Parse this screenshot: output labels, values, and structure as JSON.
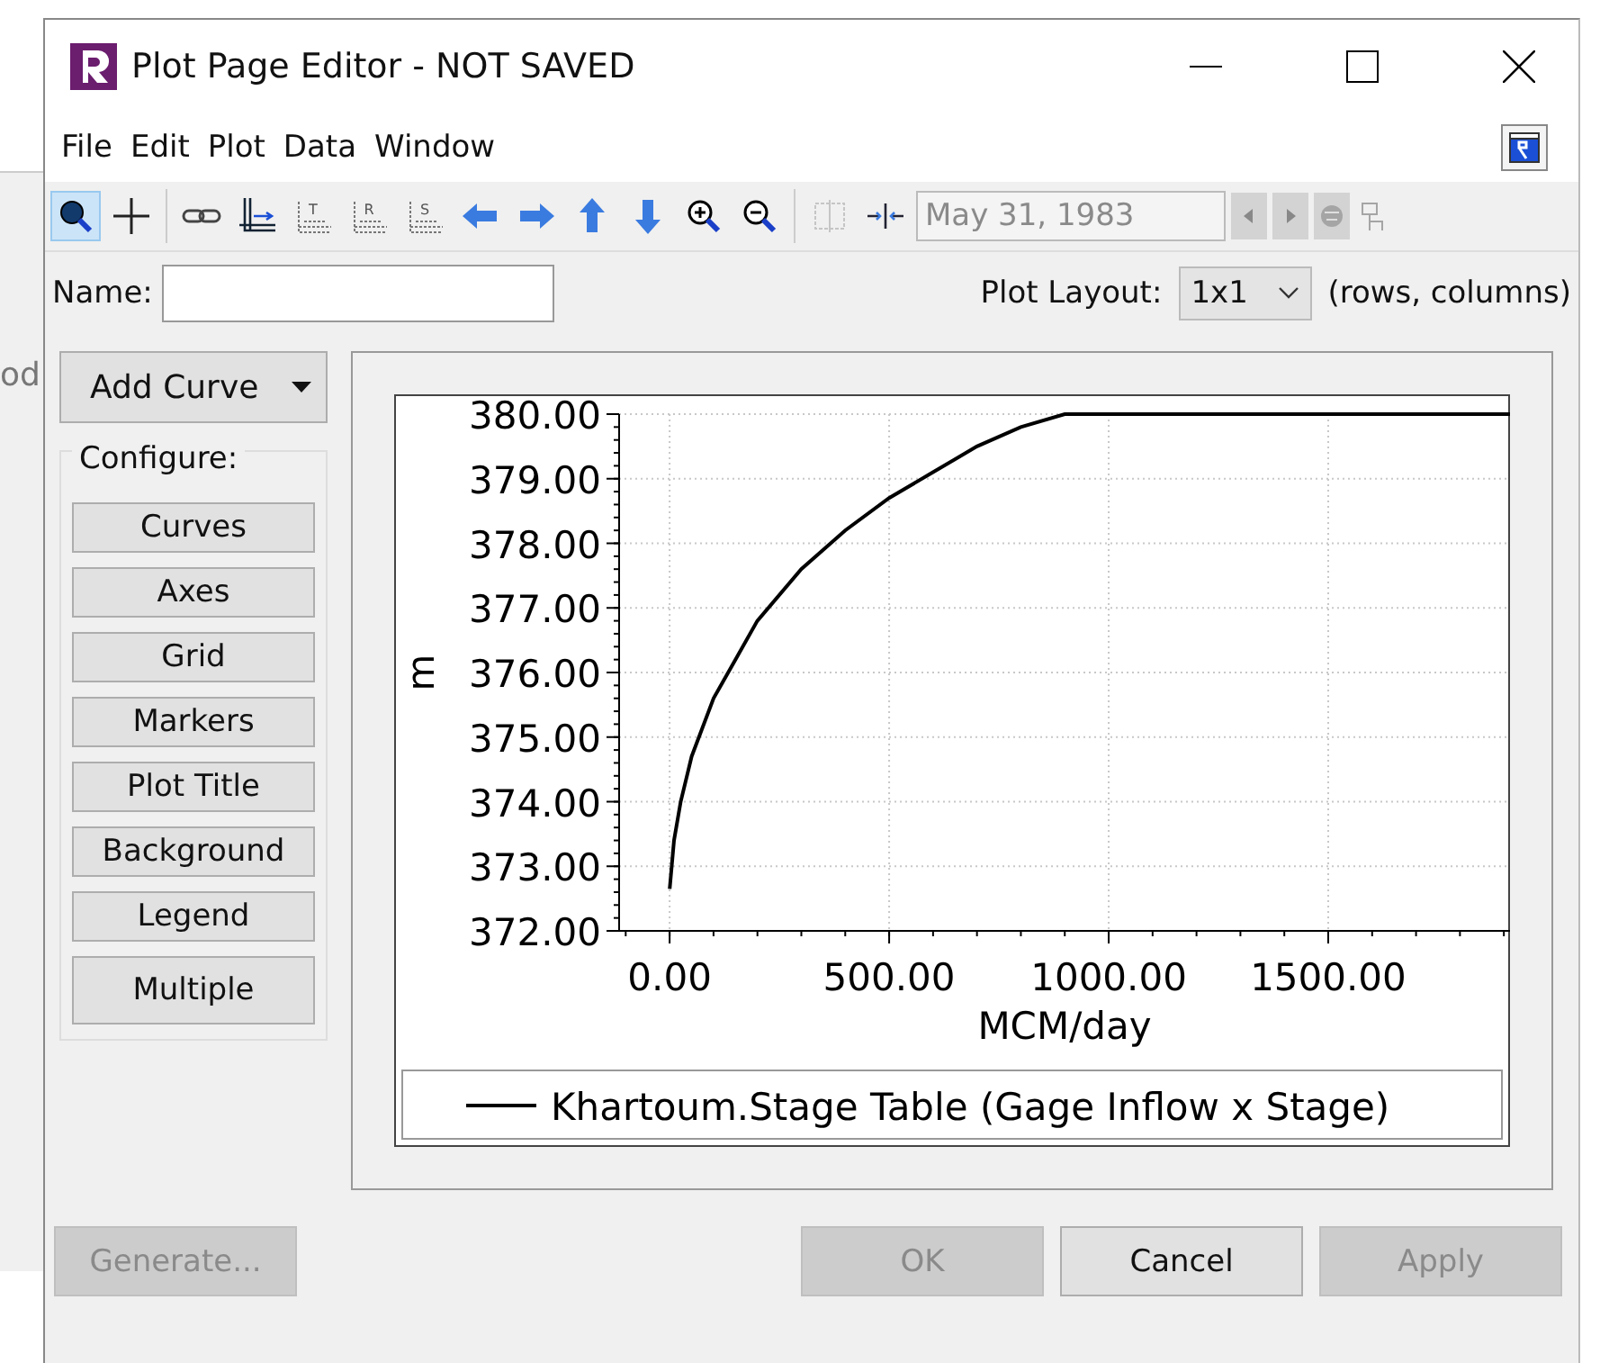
{
  "background_window": {
    "fragment": "od"
  },
  "window": {
    "title": "Plot Page Editor - NOT SAVED",
    "controls": [
      {
        "kind": "minimize"
      },
      {
        "kind": "maximize"
      },
      {
        "kind": "close"
      }
    ]
  },
  "menu": {
    "items": [
      "File",
      "Edit",
      "Plot",
      "Data",
      "Window"
    ]
  },
  "toolbar": {
    "tools": [
      {
        "kind": "zoom-region",
        "selected": true,
        "disabled": false
      },
      {
        "kind": "crosshair",
        "selected": false,
        "disabled": false
      },
      {
        "kind": "sep"
      },
      {
        "kind": "link",
        "selected": false,
        "disabled": false
      },
      {
        "kind": "axis",
        "selected": false,
        "disabled": false
      },
      {
        "kind": "axis-letter",
        "label": "T",
        "selected": false,
        "disabled": false
      },
      {
        "kind": "axis-letter",
        "label": "R",
        "selected": false,
        "disabled": false
      },
      {
        "kind": "axis-letter",
        "label": "S",
        "selected": false,
        "disabled": false
      },
      {
        "kind": "arrow-left",
        "selected": false,
        "disabled": false
      },
      {
        "kind": "arrow-right",
        "selected": false,
        "disabled": false
      },
      {
        "kind": "arrow-up",
        "selected": false,
        "disabled": false
      },
      {
        "kind": "arrow-down",
        "selected": false,
        "disabled": false
      },
      {
        "kind": "zoom-in",
        "selected": false,
        "disabled": false
      },
      {
        "kind": "zoom-out",
        "selected": false,
        "disabled": false
      },
      {
        "kind": "sep"
      },
      {
        "kind": "split",
        "selected": false,
        "disabled": true
      },
      {
        "kind": "compress",
        "selected": false,
        "disabled": false
      }
    ],
    "date_field": {
      "value": "May 31, 1983",
      "disabled": true
    },
    "date_tools": [
      {
        "kind": "prev",
        "disabled": true
      },
      {
        "kind": "next",
        "disabled": true
      },
      {
        "kind": "globe",
        "disabled": true
      },
      {
        "kind": "hand",
        "disabled": true
      }
    ]
  },
  "name_field": {
    "label": "Name:"
  },
  "plot_layout": {
    "label": "Plot Layout:",
    "value": "1x1",
    "hint": "(rows, columns)"
  },
  "add_curve": {
    "label": "Add Curve"
  },
  "configure": {
    "title": "Configure:",
    "buttons": [
      "Curves",
      "Axes",
      "Grid",
      "Markers",
      "Plot Title",
      "Background",
      "Legend",
      "Multiple"
    ]
  },
  "plot": {
    "chart_data": {
      "type": "line",
      "grid": true,
      "xlabel": "MCM/day",
      "ylabel": "m",
      "xlim": [
        -115,
        1914
      ],
      "ylim": [
        372,
        380
      ],
      "xticks": [
        {
          "value": 0,
          "label": "0.00"
        },
        {
          "value": 500,
          "label": "500.00"
        },
        {
          "value": 1000,
          "label": "1000.00"
        },
        {
          "value": 1500,
          "label": "1500.00"
        }
      ],
      "yticks": [
        {
          "value": 372,
          "label": "372.00"
        },
        {
          "value": 373,
          "label": "373.00"
        },
        {
          "value": 374,
          "label": "374.00"
        },
        {
          "value": 375,
          "label": "375.00"
        },
        {
          "value": 376,
          "label": "376.00"
        },
        {
          "value": 377,
          "label": "377.00"
        },
        {
          "value": 378,
          "label": "378.00"
        },
        {
          "value": 379,
          "label": "379.00"
        },
        {
          "value": 380,
          "label": "380.00"
        }
      ],
      "x": [
        0,
        10,
        25,
        50,
        100,
        150,
        200,
        300,
        400,
        500,
        600,
        700,
        800,
        900,
        1000,
        1914
      ],
      "series": [
        {
          "name": "Khartoum.Stage Table (Gage Inflow x Stage)",
          "color": "#000000",
          "values": [
            372.65,
            373.4,
            374.0,
            374.7,
            375.6,
            376.2,
            376.8,
            377.6,
            378.2,
            378.7,
            379.1,
            379.5,
            379.8,
            380.0,
            380.0,
            380.0
          ]
        }
      ]
    }
  },
  "buttons": [
    {
      "label": "Generate...",
      "disabled": true
    },
    {
      "label": "OK",
      "disabled": true
    },
    {
      "label": "Cancel",
      "disabled": false
    },
    {
      "label": "Apply",
      "disabled": true
    }
  ]
}
